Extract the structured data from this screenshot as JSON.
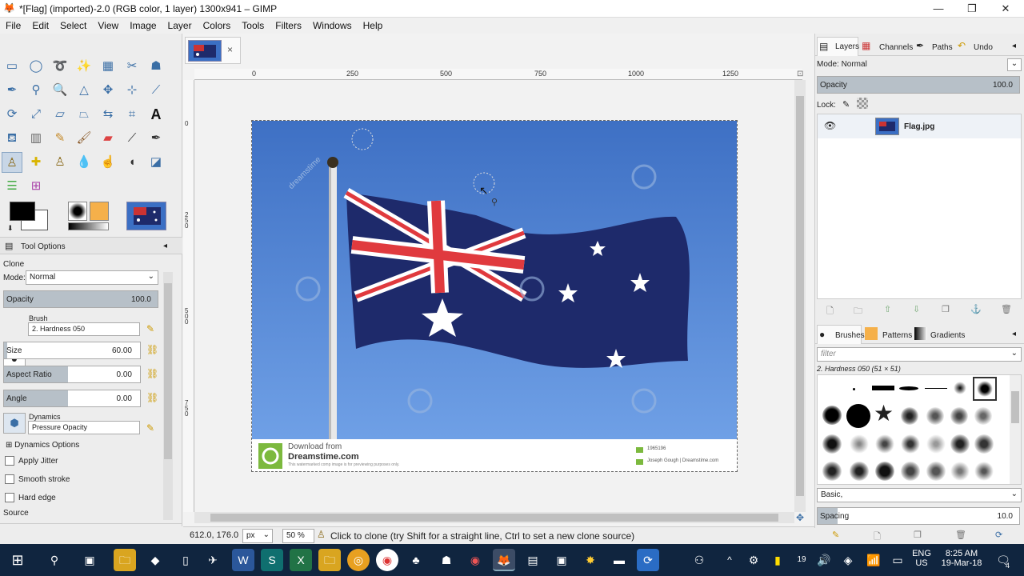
{
  "window": {
    "title": "*[Flag] (imported)-2.0 (RGB color, 1 layer) 1300x941 – GIMP"
  },
  "menu": [
    "File",
    "Edit",
    "Select",
    "View",
    "Image",
    "Layer",
    "Colors",
    "Tools",
    "Filters",
    "Windows",
    "Help"
  ],
  "image_tab": {
    "close": "×"
  },
  "ruler": {
    "marks": [
      "0",
      "250",
      "500",
      "750",
      "1000",
      "1250"
    ],
    "vmarks": [
      "0",
      "2 5 0",
      "5 0 0",
      "7 5 0"
    ]
  },
  "tool_options": {
    "panel_title": "Tool Options",
    "tool_name": "Clone",
    "mode_label": "Mode:",
    "mode_value": "Normal",
    "opacity_label": "Opacity",
    "opacity_value": "100.0",
    "opacity_level": 1.0,
    "brush_label": "Brush",
    "brush_value": "2. Hardness 050",
    "size_label": "Size",
    "size_value": "60.00",
    "aspect_label": "Aspect Ratio",
    "aspect_value": "0.00",
    "angle_label": "Angle",
    "angle_value": "0.00",
    "dynamics_label": "Dynamics",
    "dynamics_value": "Pressure Opacity",
    "dynamics_options": "Dynamics Options",
    "apply_jitter": "Apply Jitter",
    "smooth_stroke": "Smooth stroke",
    "hard_edge": "Hard edge",
    "source_label": "Source"
  },
  "layers_panel": {
    "tabs": [
      "Layers",
      "Channels",
      "Paths",
      "Undo"
    ],
    "mode_label": "Mode: Normal",
    "opacity_label": "Opacity",
    "opacity_value": "100.0",
    "opacity_level": 1.0,
    "lock_label": "Lock:",
    "layer_name": "Flag.jpg"
  },
  "brushes_panel": {
    "tabs": [
      "Brushes",
      "Patterns",
      "Gradients"
    ],
    "filter_placeholder": "filter",
    "selected_brush": "2. Hardness 050 (51 × 51)",
    "preset": "Basic,",
    "spacing_label": "Spacing",
    "spacing_value": "10.0",
    "spacing_level": 0.1
  },
  "image": {
    "watermark_download": "Download from",
    "watermark_site": "Dreamstime.com",
    "watermark_note": "This watermarked comp image is for previewing purposes only.",
    "watermark_id": "1965196",
    "watermark_credit": "Joseph Gough | Dreamstime.com",
    "watermark_text": "dreamstime"
  },
  "status": {
    "coords": "612.0, 176.0",
    "unit": "px",
    "zoom": "50 %",
    "message": "Click to clone (try Shift for a straight line, Ctrl to set a new clone source)"
  },
  "taskbar": {
    "lang_top": "ENG",
    "lang_bottom": "US",
    "time": "8:25 AM",
    "date": "19-Mar-18",
    "notification_count": "4",
    "calendar_day": "19"
  },
  "colors": {
    "accent": "#3a6ea5",
    "taskbar": "#10253f",
    "sky": "#4f86d6",
    "flag_blue": "#1e2a6b",
    "flag_red": "#e03a3e"
  }
}
